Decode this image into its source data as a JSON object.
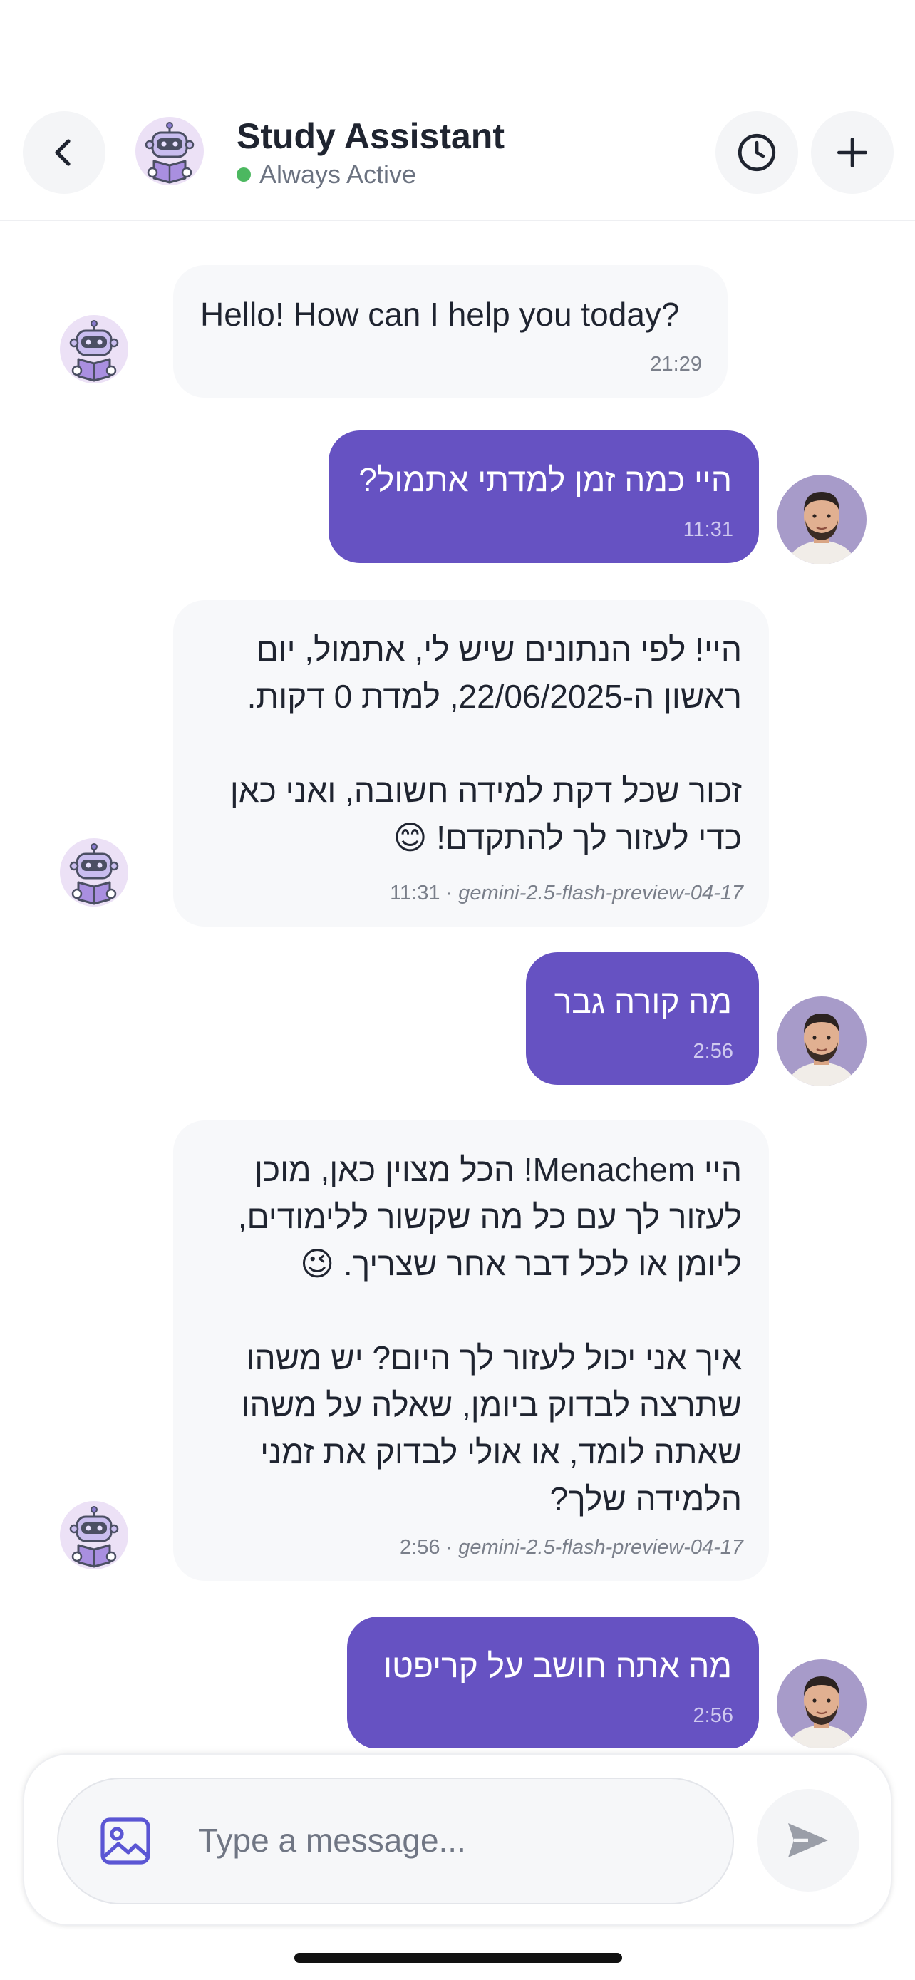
{
  "header": {
    "title": "Study Assistant",
    "status": "Always Active",
    "status_color": "#4cb860",
    "back_icon": "chevron-left-icon",
    "history_icon": "clock-icon",
    "new_chat_icon": "plus-icon"
  },
  "theme": {
    "accent": "#6652c2",
    "bot_bubble": "#f7f8fa"
  },
  "messages": [
    {
      "sender": "bot",
      "text": "Hello! How can I help you today?",
      "time": "21:29",
      "model": ""
    },
    {
      "sender": "user",
      "text": "היי כמה זמן למדתי אתמול?",
      "time": "11:31"
    },
    {
      "sender": "bot",
      "text": "היי! לפי הנתונים שיש לי, אתמול, יום ראשון ה-22/06/2025, למדת 0 דקות.\n\nזכור שכל דקת למידה חשובה, ואני כאן כדי לעזור לך להתקדם! 😊",
      "time": "11:31",
      "model": "gemini-2.5-flash-preview-04-17"
    },
    {
      "sender": "user",
      "text": "מה קורה גבר",
      "time": "2:56"
    },
    {
      "sender": "bot",
      "text": "היי Menachem! הכל מצוין כאן, מוכן לעזור לך עם כל מה שקשור ללימודים, ליומן או לכל דבר אחר שצריך. 😉\n\nאיך אני יכול לעזור לך היום? יש משהו שתרצה לבדוק ביומן, שאלה על משהו שאתה לומד, או אולי לבדוק את זמני הלמידה שלך?",
      "time": "2:56",
      "model": "gemini-2.5-flash-preview-04-17"
    },
    {
      "sender": "user",
      "text": "מה אתה חושב על קריפטו",
      "time": "2:56"
    }
  ],
  "composer": {
    "placeholder": "Type a message...",
    "value": "",
    "image_icon": "image-icon",
    "send_icon": "send-icon"
  }
}
